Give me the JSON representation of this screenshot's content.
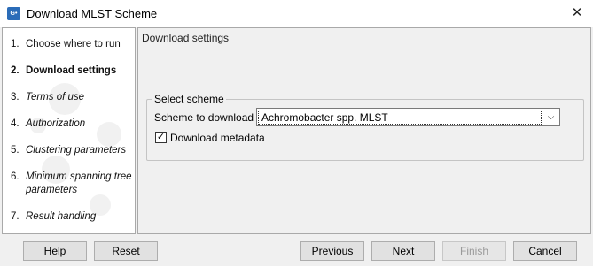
{
  "window": {
    "title": "Download MLST Scheme",
    "icon_text": "G•",
    "close_glyph": "✕"
  },
  "steps": [
    {
      "num": "1.",
      "label": "Choose where to run"
    },
    {
      "num": "2.",
      "label": "Download settings"
    },
    {
      "num": "3.",
      "label": "Terms of use"
    },
    {
      "num": "4.",
      "label": "Authorization"
    },
    {
      "num": "5.",
      "label": "Clustering parameters"
    },
    {
      "num": "6.",
      "label": "Minimum spanning tree"
    },
    {
      "num": "",
      "label": "parameters"
    },
    {
      "num": "7.",
      "label": "Result handling"
    }
  ],
  "content": {
    "header": "Download settings",
    "group_title": "Select scheme",
    "scheme_label": "Scheme to download",
    "scheme_value": "Achromobacter spp. MLST",
    "dropdown_glyph": "⌵",
    "metadata_label": "Download metadata",
    "metadata_checked": true,
    "check_glyph": "✓"
  },
  "buttons": {
    "help": "Help",
    "reset": "Reset",
    "previous": "Previous",
    "next": "Next",
    "finish": "Finish",
    "cancel": "Cancel"
  }
}
